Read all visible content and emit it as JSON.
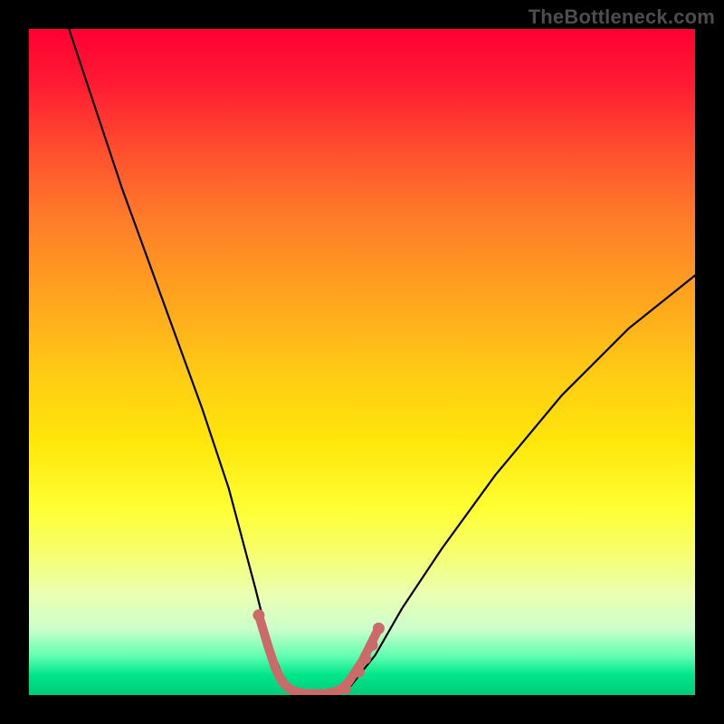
{
  "watermark": {
    "text": "TheBottleneck.com"
  },
  "chart_data": {
    "type": "line",
    "title": "",
    "xlabel": "",
    "ylabel": "",
    "xlim": [
      0,
      100
    ],
    "ylim": [
      0,
      100
    ],
    "grid": false,
    "legend": false,
    "background_gradient": {
      "stops": [
        {
          "pos": 0.0,
          "color": "#ff0033"
        },
        {
          "pos": 0.4,
          "color": "#ffa31f"
        },
        {
          "pos": 0.72,
          "color": "#ffff33"
        },
        {
          "pos": 0.97,
          "color": "#00e68a"
        },
        {
          "pos": 1.0,
          "color": "#00cc7a"
        }
      ]
    },
    "series": [
      {
        "name": "bottleneck-curve",
        "color": "#000000",
        "x": [
          6,
          10,
          14,
          18,
          22,
          26,
          30,
          34,
          36,
          38,
          40,
          42,
          44,
          46,
          48,
          52,
          56,
          62,
          70,
          80,
          90,
          100
        ],
        "y": [
          100,
          88,
          76,
          65,
          54,
          43,
          31,
          16,
          8,
          3,
          0,
          0,
          0,
          0,
          1,
          6,
          13,
          22,
          33,
          45,
          55,
          63
        ]
      },
      {
        "name": "optimal-zone-marker",
        "color": "#cc6a6a",
        "x": [
          34.5,
          36,
          37,
          38,
          39,
          40,
          41,
          42,
          43,
          44,
          45,
          46,
          47,
          48,
          49,
          50,
          51,
          52.5
        ],
        "y": [
          12,
          7,
          4,
          2,
          1,
          0.5,
          0.3,
          0.2,
          0.2,
          0.2,
          0.3,
          0.5,
          1,
          2,
          3.5,
          5,
          7,
          10
        ]
      }
    ],
    "marker_dots": {
      "color": "#cc6a6a",
      "points": [
        {
          "x": 34.5,
          "y": 12
        },
        {
          "x": 47.5,
          "y": 1
        },
        {
          "x": 49.5,
          "y": 3.5
        },
        {
          "x": 50.5,
          "y": 5.5
        },
        {
          "x": 51.5,
          "y": 7.5
        },
        {
          "x": 52.5,
          "y": 10
        }
      ]
    }
  }
}
